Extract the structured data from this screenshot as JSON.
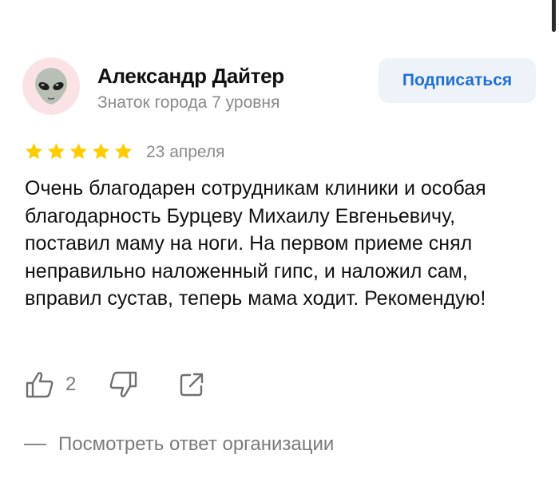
{
  "review": {
    "author": {
      "name": "Александр Дайтер",
      "level": "Знаток города 7 уровня",
      "avatar_icon": "alien-face-icon"
    },
    "subscribe_label": "Подписаться",
    "rating": {
      "value": 5,
      "max": 5,
      "color": "#ffcc00"
    },
    "date": "23 апреля",
    "text": "Очень благодарен сотрудникам клиники и особая благодарность Бурцеву Михаилу Евгеньевичу, поставил маму на ноги. На первом приеме снял неправильно наложенный гипс, и наложил сам, вправил сустав, теперь мама ходит. Рекомендую!",
    "actions": {
      "like_icon": "thumbs-up-icon",
      "like_count": "2",
      "dislike_icon": "thumbs-down-icon",
      "share_icon": "share-icon"
    },
    "answer_link": "Посмотреть ответ организации"
  },
  "colors": {
    "accent": "#1f6fd6",
    "button_bg": "#eef3fa",
    "secondary_text": "#8a8a8a",
    "avatar_bg": "#fbe3e5"
  }
}
